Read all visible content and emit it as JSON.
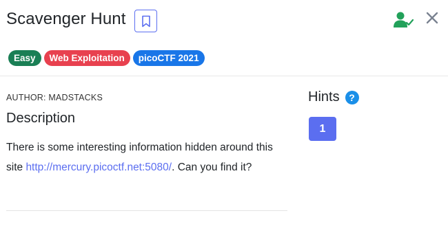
{
  "challenge": {
    "title": "Scavenger Hunt",
    "badges": {
      "difficulty": "Easy",
      "category": "Web Exploitation",
      "event": "picoCTF 2021"
    },
    "author": "AUTHOR: MADSTACKS",
    "description_heading": "Description",
    "description": {
      "before_link": "There is some interesting information hidden around this site ",
      "link": "http://mercury.picoctf.net:5080/",
      "after_link": ". Can you find it?"
    }
  },
  "hints": {
    "title": "Hints",
    "help_glyph": "?",
    "items": [
      "1"
    ]
  },
  "icons": {
    "bookmark": "bookmark-icon",
    "solved": "user-check-icon",
    "close": "close-icon",
    "help": "question-circle-icon"
  },
  "colors": {
    "accent": "#5b6ef0",
    "easy": "#1a7f55",
    "category": "#e8414f",
    "event": "#1976e8",
    "solved": "#22a15a"
  }
}
